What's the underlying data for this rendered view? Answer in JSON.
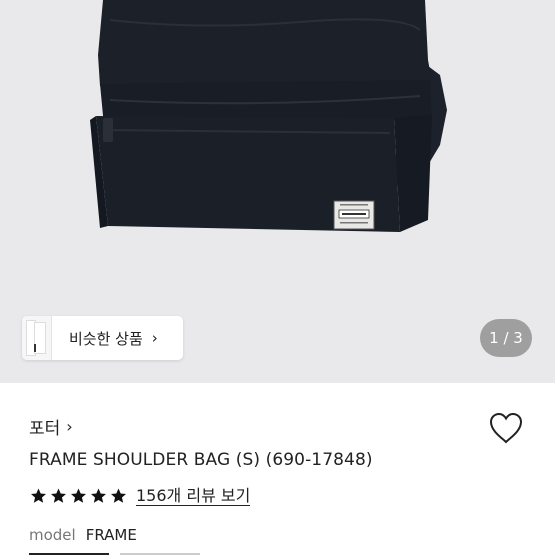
{
  "gallery": {
    "similar_label": "비슷한 상품",
    "similar_chevron": "›",
    "page_counter": "1 / 3",
    "bag_tag_text": "PORTER"
  },
  "product": {
    "brand": "포터",
    "brand_chevron": "›",
    "title": "FRAME SHOULDER BAG (S) (690-17848)",
    "rating_stars": 5,
    "review_link": "156개 리뷰 보기",
    "model_label": "model",
    "model_value": "FRAME"
  },
  "colors": {
    "gallery_bg": "#e9e9eb",
    "bag": "#1b1f29",
    "text": "#222222"
  }
}
